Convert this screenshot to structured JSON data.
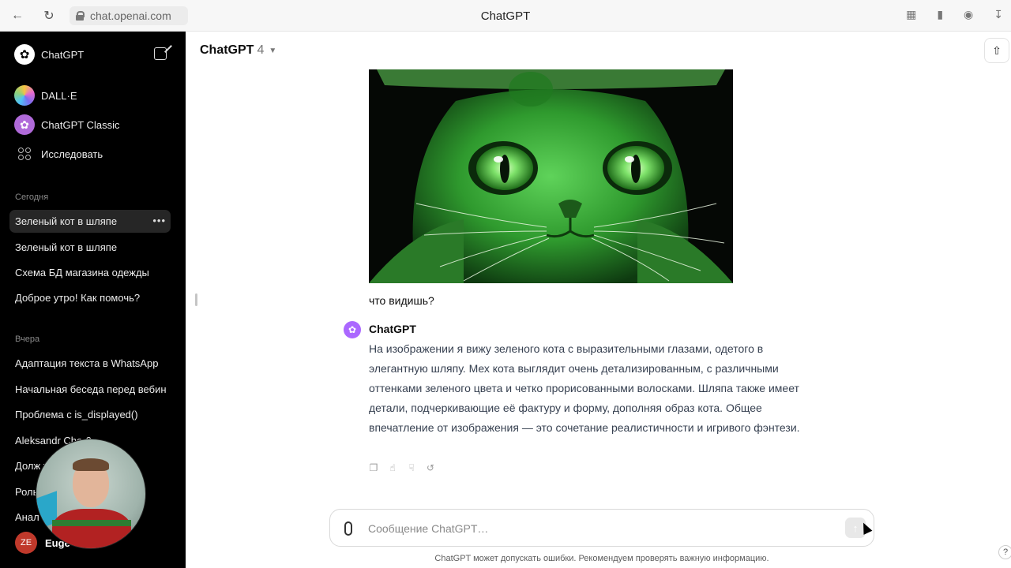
{
  "browser": {
    "url": "chat.openai.com",
    "tab_title": "ChatGPT"
  },
  "sidebar": {
    "app_name": "ChatGPT",
    "gpts": [
      {
        "label": "DALL·E"
      },
      {
        "label": "ChatGPT Classic"
      },
      {
        "label": "Исследовать"
      }
    ],
    "sections": [
      {
        "title": "Сегодня",
        "items": [
          {
            "label": "Зеленый кот в шляпе",
            "active": true
          },
          {
            "label": "Зеленый кот в шляпе"
          },
          {
            "label": "Схема БД магазина одежды"
          },
          {
            "label": "Доброе утро! Как помочь?"
          }
        ]
      },
      {
        "title": "Вчера",
        "items": [
          {
            "label": "Адаптация текста в WhatsApp"
          },
          {
            "label": "Начальная беседа перед вебин"
          },
          {
            "label": "Проблема с is_displayed()"
          },
          {
            "label": "Aleksandr Che-0"
          },
          {
            "label": "Долж                     толо"
          },
          {
            "label": "Роль                      нге"
          },
          {
            "label": "Анал                      ози"
          }
        ]
      }
    ],
    "user": {
      "initials": "ZE",
      "name": "Euge"
    }
  },
  "main": {
    "model_name": "ChatGPT",
    "model_version": "4",
    "user_message": "что видишь?",
    "assistant_name": "ChatGPT",
    "assistant_message": "На изображении я вижу зеленого кота с выразительными глазами, одетого в элегантную шляпу. Мех кота выглядит очень детализированным, с различными оттенками зеленого цвета и четко прорисованными волосками. Шляпа также имеет детали, подчеркивающие её фактуру и форму, дополняя образ кота. Общее впечатление от изображения — это сочетание реалистичности и игривого фэнтези.",
    "composer_placeholder": "Сообщение ChatGPT…",
    "disclaimer": "ChatGPT может допускать ошибки. Рекомендуем проверять важную информацию.",
    "help": "?"
  },
  "colors": {
    "sidebar_bg": "#000000",
    "accent_purple": "#ab68ff",
    "cat_green": "#3fae3a"
  }
}
